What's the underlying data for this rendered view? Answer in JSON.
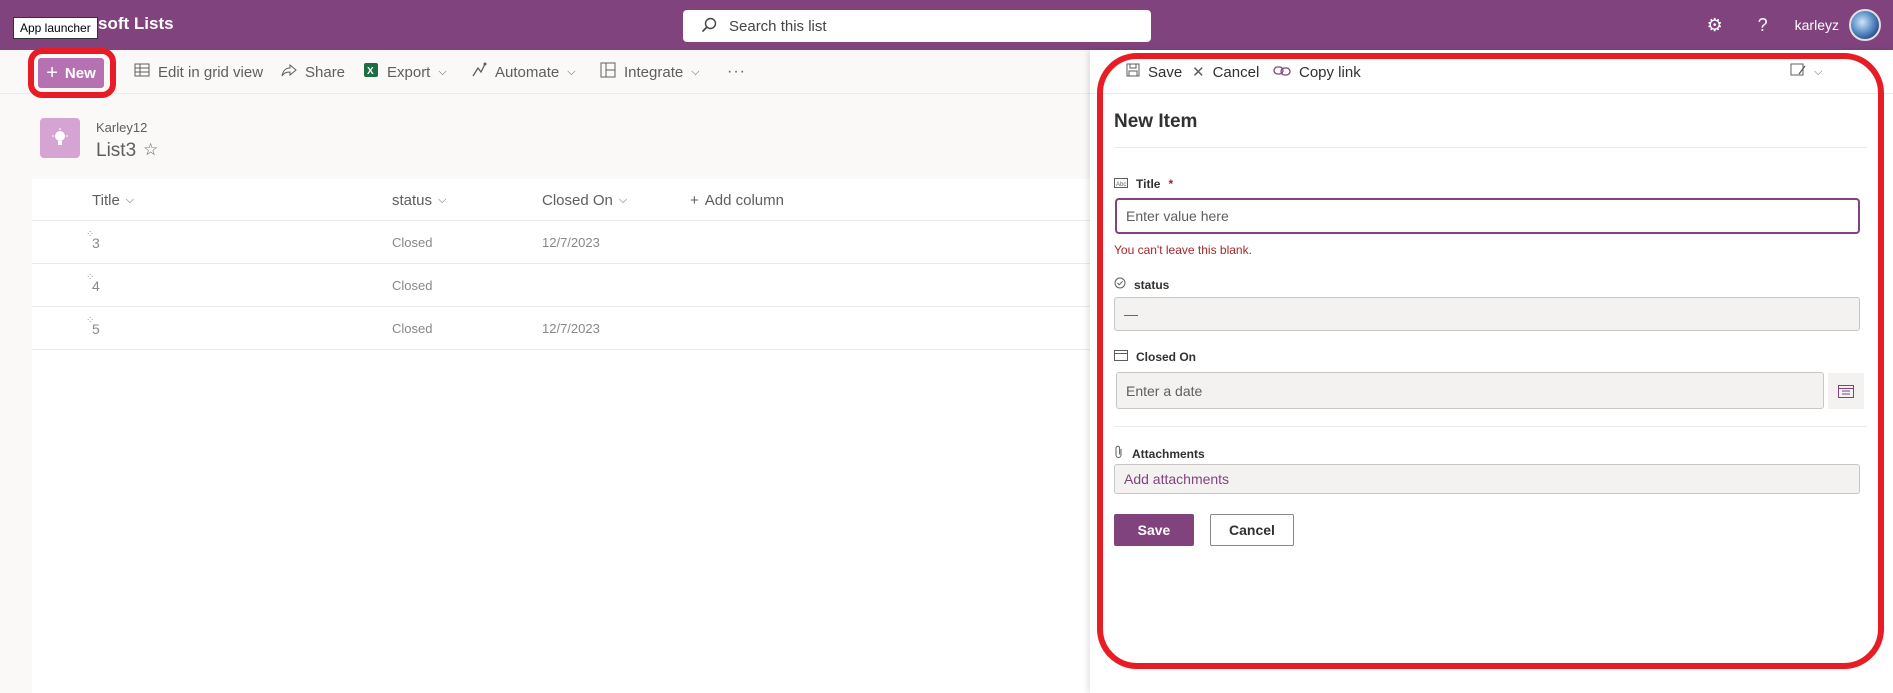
{
  "suite": {
    "tooltip": "App launcher",
    "app_title": "soft Lists",
    "search_placeholder": "Search this list",
    "username": "karleyz"
  },
  "commands": {
    "new": "New",
    "edit_grid": "Edit in grid view",
    "share": "Share",
    "export": "Export",
    "automate": "Automate",
    "integrate": "Integrate",
    "more": "···"
  },
  "list": {
    "site_name": "Karley12",
    "list_name": "List3",
    "columns": [
      "Title",
      "status",
      "Closed On"
    ],
    "add_column": "Add column",
    "rows": [
      {
        "title": "3",
        "status": "Closed",
        "closed_on": "12/7/2023"
      },
      {
        "title": "4",
        "status": "Closed",
        "closed_on": ""
      },
      {
        "title": "5",
        "status": "Closed",
        "closed_on": "12/7/2023"
      }
    ]
  },
  "panel": {
    "cmd_save": "Save",
    "cmd_cancel": "Cancel",
    "cmd_copy_link": "Copy link",
    "heading": "New Item",
    "title_label": "Title",
    "required_mark": "*",
    "title_placeholder": "Enter value here",
    "title_error": "You can't leave this blank.",
    "status_label": "status",
    "status_value": "—",
    "closed_on_label": "Closed On",
    "date_placeholder": "Enter a date",
    "attachments_label": "Attachments",
    "add_attachments": "Add attachments",
    "save_button": "Save",
    "cancel_button": "Cancel"
  },
  "colors": {
    "brand": "#80437e",
    "annotation": "#e81c24",
    "error": "#a4262c"
  }
}
